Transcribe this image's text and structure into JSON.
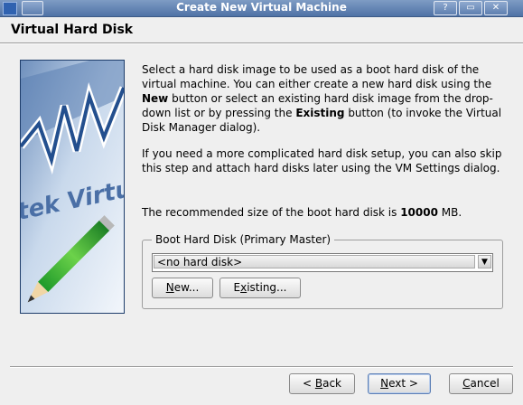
{
  "window": {
    "title": "Create New Virtual Machine",
    "help_glyph": "?",
    "minimize_glyph": "▭",
    "close_glyph": "✕"
  },
  "page": {
    "heading": "Virtual Hard Disk"
  },
  "description": {
    "p1_a": "Select a hard disk image to be used as a boot hard disk of the virtual machine. You can either create a new hard disk using the ",
    "p1_new": "New",
    "p1_b": " button or select an existing hard disk image from the drop-down list or by pressing the ",
    "p1_existing": "Existing",
    "p1_c": " button (to invoke the Virtual Disk Manager dialog).",
    "p2": "If you need a more complicated hard disk setup, you can also skip this step and attach hard disks later using the VM Settings dialog.",
    "p3_a": "The recommended size of the boot hard disk is ",
    "p3_size": "10000",
    "p3_b": " MB."
  },
  "boot_disk": {
    "group_title": "Boot Hard Disk (Primary Master)",
    "selected": "<no hard disk>",
    "new_label_mnemonic": "N",
    "new_label_rest": "ew...",
    "existing_label_pre": "E",
    "existing_label_mnemonic": "x",
    "existing_label_rest": "isting..."
  },
  "buttons": {
    "back_pre": "< ",
    "back_mnemonic": "B",
    "back_rest": "ack",
    "next_mnemonic": "N",
    "next_rest": "ext >",
    "cancel_mnemonic": "C",
    "cancel_rest": "ancel"
  },
  "picture": {
    "watermark_text": "tek Virtua"
  }
}
